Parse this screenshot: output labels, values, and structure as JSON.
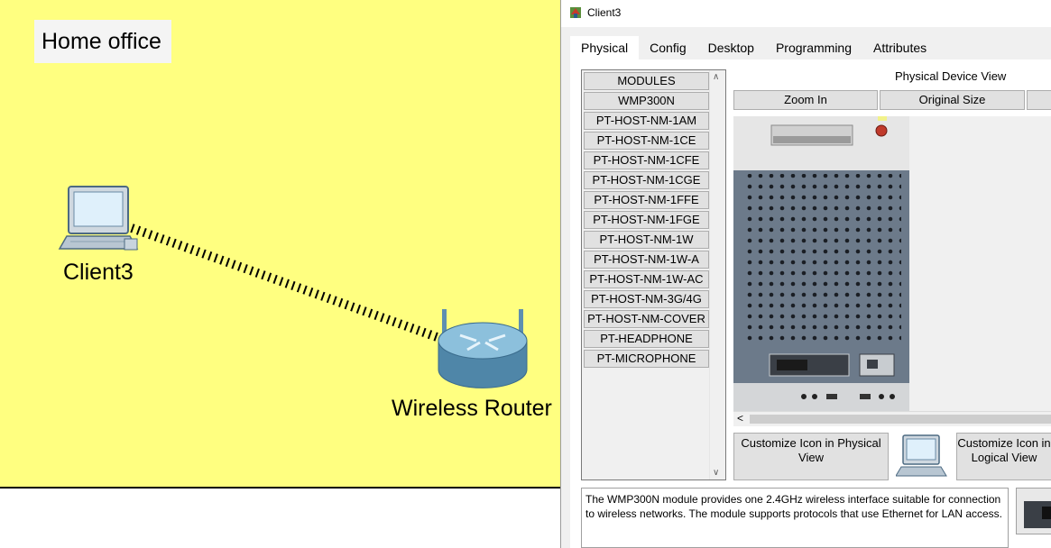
{
  "workspace": {
    "area_label": "Home office",
    "client_label": "Client3",
    "router_label": "Wireless Router"
  },
  "window": {
    "title": "Client3",
    "tabs": [
      "Physical",
      "Config",
      "Desktop",
      "Programming",
      "Attributes"
    ],
    "active_tab": "Physical"
  },
  "modules": {
    "items": [
      "MODULES",
      "WMP300N",
      "PT-HOST-NM-1AM",
      "PT-HOST-NM-1CE",
      "PT-HOST-NM-1CFE",
      "PT-HOST-NM-1CGE",
      "PT-HOST-NM-1FFE",
      "PT-HOST-NM-1FGE",
      "PT-HOST-NM-1W",
      "PT-HOST-NM-1W-A",
      "PT-HOST-NM-1W-AC",
      "PT-HOST-NM-3G/4G",
      "PT-HOST-NM-COVER",
      "PT-HEADPHONE",
      "PT-MICROPHONE"
    ]
  },
  "device_view": {
    "title": "Physical Device View",
    "zoom_in": "Zoom In",
    "original_size": "Original Size"
  },
  "customize": {
    "physical": "Customize Icon in Physical View",
    "logical": "Customize Icon in Logical View"
  },
  "description": "The WMP300N module provides one 2.4GHz wireless interface suitable for connection to wireless networks. The module supports protocols that use Ethernet for LAN access.",
  "colors": {
    "workspace_bg": "#ffff80",
    "tab_accent": "#2b5797"
  },
  "icons": [
    "pc-icon",
    "wireless-router-icon",
    "app-icon",
    "chevron-up-icon",
    "chevron-down-icon",
    "chevron-left-icon"
  ]
}
